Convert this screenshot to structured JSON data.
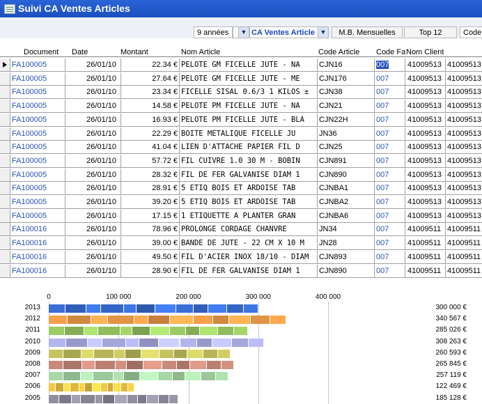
{
  "window": {
    "title": "Suivi CA Ventes Articles"
  },
  "toolbar": {
    "period_value": "9 années",
    "report_value": "CA Ventes Article",
    "mode_label": "M.B. Mensuelles",
    "top_label": "Top 12",
    "code_label": "Code"
  },
  "columns": {
    "document": "Document",
    "date": "Date",
    "montant": "Montant",
    "nom_article": "Nom Article",
    "code_article": "Code Article",
    "code_fa": "Code Fa",
    "nom_client": "Nom Client"
  },
  "rows": [
    {
      "doc": "FA100005",
      "date": "26/01/10",
      "montant": "22.34 €",
      "nom": "PELOTE GM FICELLE JUTE - NA",
      "code": "CJN16",
      "fa": "007",
      "c1": "41009513",
      "c2": "41009513"
    },
    {
      "doc": "FA100005",
      "date": "26/01/10",
      "montant": "27.64 €",
      "nom": "PELOTE GM FICELLE JUTE - ME",
      "code": "CJN176",
      "fa": "007",
      "c1": "41009513",
      "c2": "41009513"
    },
    {
      "doc": "FA100005",
      "date": "26/01/10",
      "montant": "23.34 €",
      "nom": "FICELLE SISAL 0.6/3 1 KILOS ±",
      "code": "CJN38",
      "fa": "007",
      "c1": "41009513",
      "c2": "41009513"
    },
    {
      "doc": "FA100005",
      "date": "26/01/10",
      "montant": "14.58 €",
      "nom": "PELOTE PM FICELLE JUTE - NA",
      "code": "CJN21",
      "fa": "007",
      "c1": "41009513",
      "c2": "41009513"
    },
    {
      "doc": "FA100005",
      "date": "26/01/10",
      "montant": "16.93 €",
      "nom": "PELOTE PM FICELLE JUTE - BLA",
      "code": "CJN22H",
      "fa": "007",
      "c1": "41009513",
      "c2": "41009513"
    },
    {
      "doc": "FA100005",
      "date": "26/01/10",
      "montant": "22.29 €",
      "nom": "BOITE METALIQUE FICELLE JU",
      "code": "JN36",
      "fa": "007",
      "c1": "41009513",
      "c2": "41009513"
    },
    {
      "doc": "FA100005",
      "date": "26/01/10",
      "montant": "41.04 €",
      "nom": "LIEN D'ATTACHE PAPIER FIL D",
      "code": "CJN25",
      "fa": "007",
      "c1": "41009513",
      "c2": "41009513"
    },
    {
      "doc": "FA100005",
      "date": "26/01/10",
      "montant": "57.72 €",
      "nom": "FIL CUIVRE 1.0   30 M - BOBIN",
      "code": "CJN891",
      "fa": "007",
      "c1": "41009513",
      "c2": "41009513"
    },
    {
      "doc": "FA100005",
      "date": "26/01/10",
      "montant": "28.32 €",
      "nom": "FIL DE FER GALVANISE DIAM 1",
      "code": "CJN890",
      "fa": "007",
      "c1": "41009513",
      "c2": "41009513"
    },
    {
      "doc": "FA100005",
      "date": "26/01/10",
      "montant": "28.91 €",
      "nom": "5 ETIQ BOIS ET ARDOISE TAB",
      "code": "CJNBA1",
      "fa": "007",
      "c1": "41009513",
      "c2": "41009513"
    },
    {
      "doc": "FA100005",
      "date": "26/01/10",
      "montant": "39.20 €",
      "nom": "5 ETIQ BOIS ET ARDOISE TAB",
      "code": "CJNBA2",
      "fa": "007",
      "c1": "41009513",
      "c2": "41009513"
    },
    {
      "doc": "FA100005",
      "date": "26/01/10",
      "montant": "17.15 €",
      "nom": "1 ETIQUETTE A PLANTER GRAN",
      "code": "CJNBA6",
      "fa": "007",
      "c1": "41009513",
      "c2": "41009513"
    },
    {
      "doc": "FA100016",
      "date": "26/01/10",
      "montant": "78.96 €",
      "nom": "PROLONGE CORDAGE CHANVRE",
      "code": "JN34",
      "fa": "007",
      "c1": "41009511",
      "c2": "41009511"
    },
    {
      "doc": "FA100016",
      "date": "26/01/10",
      "montant": "39.00 €",
      "nom": "BANDE DE JUTE - 22 CM X 10 M",
      "code": "JN28",
      "fa": "007",
      "c1": "41009511",
      "c2": "41009511"
    },
    {
      "doc": "FA100016",
      "date": "26/01/10",
      "montant": "49.50 €",
      "nom": "FIL D'ACIER INOX 18/10 - DIAM",
      "code": "CJN893",
      "fa": "007",
      "c1": "41009511",
      "c2": "41009511"
    },
    {
      "doc": "FA100016",
      "date": "26/01/10",
      "montant": "28.90 €",
      "nom": "FIL DE FER GALVANISE DIAM 1",
      "code": "CJN890",
      "fa": "007",
      "c1": "41009511",
      "c2": "41009511"
    }
  ],
  "chart_data": {
    "type": "bar",
    "orientation": "horizontal-stacked",
    "xticks": [
      "0",
      "100 000",
      "200 000",
      "300 000",
      "400 000"
    ],
    "xlim": [
      0,
      400000
    ],
    "categories": [
      "2013",
      "2012",
      "2011",
      "2010",
      "2009",
      "2008",
      "2007",
      "2006",
      "2005"
    ],
    "totals_labels": [
      "300 000 €",
      "340 567 €",
      "285 026 €",
      "308 263 €",
      "260 593 €",
      "265 845 €",
      "257 119 €",
      "122 469 €",
      "185 128 €"
    ],
    "totals": [
      300000,
      340567,
      285026,
      308263,
      260593,
      265845,
      257119,
      122469,
      185128
    ],
    "colors": [
      "#3a6fd8",
      "#f7a04a",
      "#9ccc65",
      "#b4b4f0",
      "#c6c45e",
      "#c98a7a",
      "#a8d8a8",
      "#f5c842",
      "#9090a0"
    ]
  }
}
